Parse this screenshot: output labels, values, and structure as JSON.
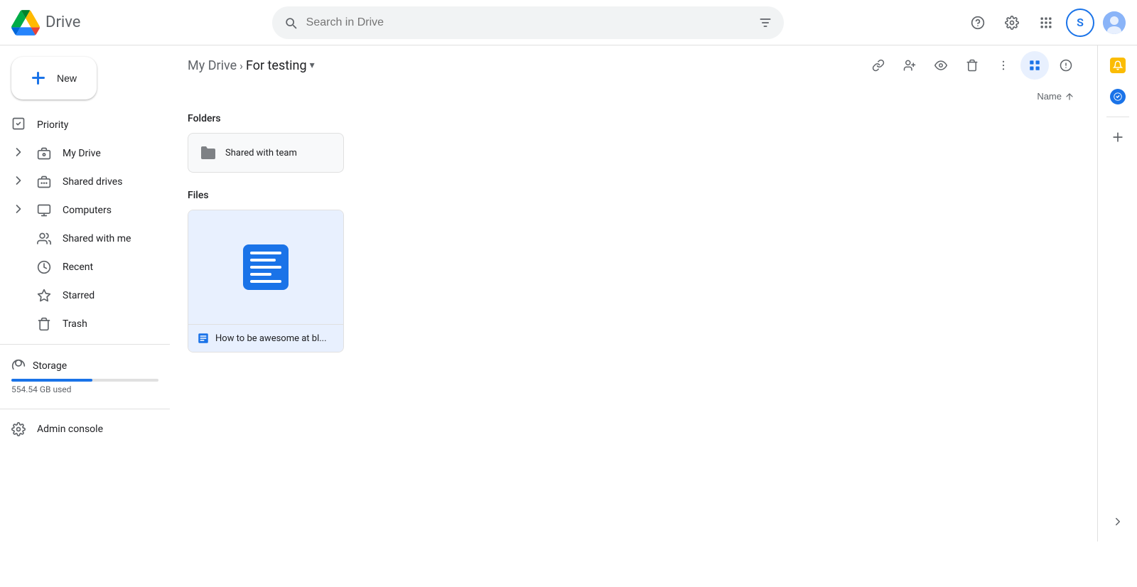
{
  "app": {
    "title": "Drive",
    "logo_text": "Drive"
  },
  "header": {
    "search_placeholder": "Search in Drive",
    "help_tooltip": "Help",
    "settings_tooltip": "Settings",
    "apps_tooltip": "Google apps",
    "account_initial": "S"
  },
  "sidebar": {
    "new_label": "New",
    "items": [
      {
        "id": "priority",
        "label": "Priority",
        "icon": "☑"
      },
      {
        "id": "my-drive",
        "label": "My Drive",
        "icon": "🖥"
      },
      {
        "id": "shared-drives",
        "label": "Shared drives",
        "icon": "🖥"
      },
      {
        "id": "computers",
        "label": "Computers",
        "icon": "💻"
      },
      {
        "id": "shared-with-me",
        "label": "Shared with me",
        "icon": "👥"
      },
      {
        "id": "recent",
        "label": "Recent",
        "icon": "🕐"
      },
      {
        "id": "starred",
        "label": "Starred",
        "icon": "☆"
      },
      {
        "id": "trash",
        "label": "Trash",
        "icon": "🗑"
      }
    ],
    "storage": {
      "label": "Storage",
      "used_text": "554.54 GB used",
      "percent": 55
    },
    "admin_label": "Admin console"
  },
  "content": {
    "breadcrumb": {
      "parent": "My Drive",
      "current": "For testing"
    },
    "sort": {
      "label": "Name",
      "direction": "asc"
    },
    "sections": {
      "folders_title": "Folders",
      "files_title": "Files"
    },
    "folders": [
      {
        "name": "Shared with team"
      }
    ],
    "files": [
      {
        "name": "How to be awesome at bl...",
        "type": "doc"
      }
    ]
  },
  "right_panel": {
    "expand_label": "Expand"
  }
}
